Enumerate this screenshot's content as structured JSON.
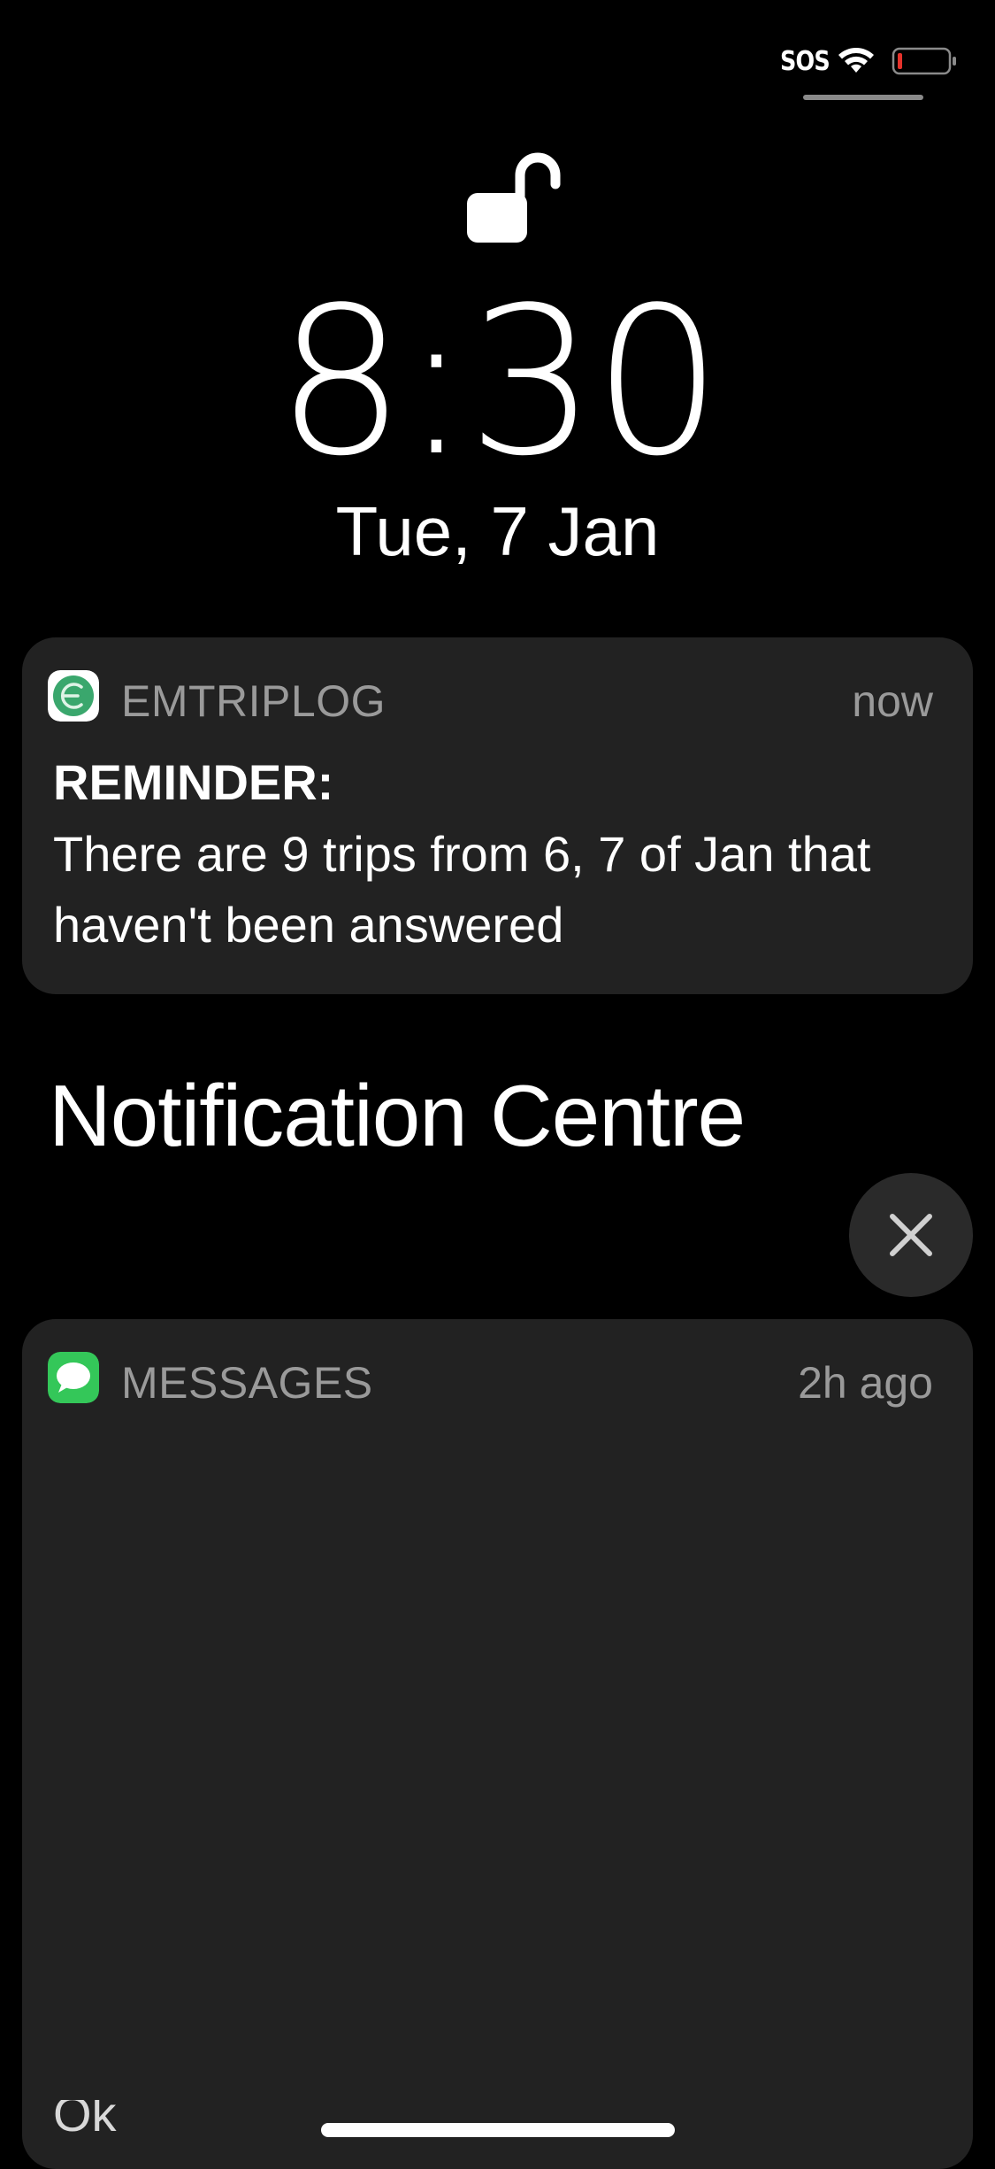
{
  "status_bar": {
    "carrier_text": "SOS",
    "battery_color": "#e5322b",
    "wifi_icon": "wifi-icon",
    "battery_icon": "battery-low-icon"
  },
  "lock_screen": {
    "lock_icon": "unlocked-padlock-icon",
    "time": "8:30",
    "date": "Tue, 7 Jan"
  },
  "notifications": [
    {
      "app": "EMTRIPLOG",
      "time": "now",
      "title": "REMINDER:",
      "body": "There are 9 trips from 6, 7 of Jan that haven't been answered",
      "icon": "emtriplog-app-icon",
      "icon_color": "#3aa76d"
    },
    {
      "app": "MESSAGES",
      "time": "2h ago",
      "icon": "messages-app-icon",
      "icon_color": "#34c759",
      "partial_text": "Ok"
    }
  ],
  "notification_centre": {
    "heading": "Notification Centre",
    "clear_icon": "close-icon"
  }
}
